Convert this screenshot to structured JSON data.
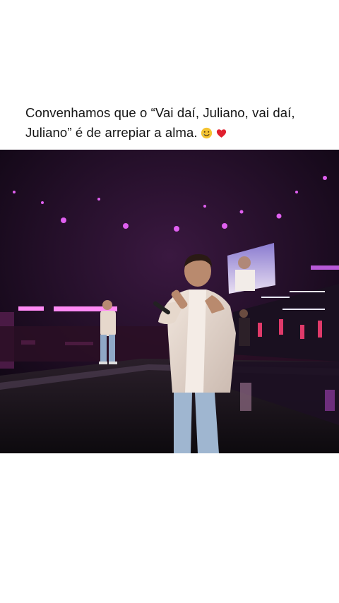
{
  "post": {
    "caption_line1": "Convenhamos que o “Vai daí, Juliano, vai daí,",
    "caption_line2": "Juliano” é de arrepiar a alma.",
    "emojis": [
      "smiling-face-with-tear-icon",
      "red-heart-icon"
    ]
  },
  "media": {
    "kind": "video-frame",
    "scene": "concert-stage",
    "accent_color": "#c04cd8"
  }
}
